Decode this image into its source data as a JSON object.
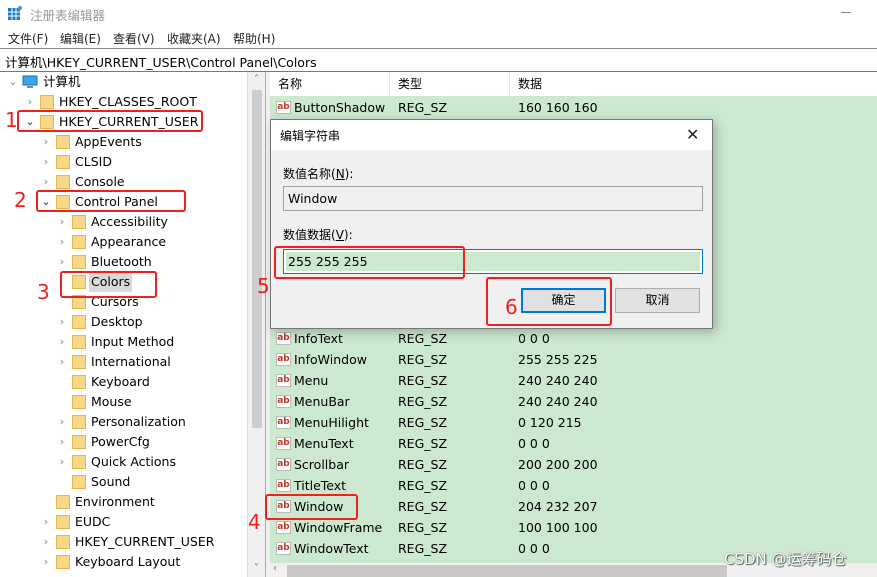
{
  "window": {
    "title": "注册表编辑器",
    "menu": [
      "文件(F)",
      "编辑(E)",
      "查看(V)",
      "收藏夹(A)",
      "帮助(H)"
    ],
    "address": "计算机\\HKEY_CURRENT_USER\\Control Panel\\Colors"
  },
  "tree": {
    "root": "计算机",
    "items": [
      {
        "label": "HKEY_CLASSES_ROOT",
        "level": 1,
        "expander": "collapsed"
      },
      {
        "label": "HKEY_CURRENT_USER",
        "level": 1,
        "expander": "expanded"
      },
      {
        "label": "AppEvents",
        "level": 2,
        "expander": "collapsed"
      },
      {
        "label": "CLSID",
        "level": 2,
        "expander": "collapsed"
      },
      {
        "label": "Console",
        "level": 2,
        "expander": "collapsed"
      },
      {
        "label": "Control Panel",
        "level": 2,
        "expander": "expanded"
      },
      {
        "label": "Accessibility",
        "level": 3,
        "expander": "collapsed"
      },
      {
        "label": "Appearance",
        "level": 3,
        "expander": "collapsed"
      },
      {
        "label": "Bluetooth",
        "level": 3,
        "expander": "collapsed"
      },
      {
        "label": "Colors",
        "level": 3,
        "expander": "none",
        "selected": true
      },
      {
        "label": "Cursors",
        "level": 3,
        "expander": "none"
      },
      {
        "label": "Desktop",
        "level": 3,
        "expander": "collapsed"
      },
      {
        "label": "Input Method",
        "level": 3,
        "expander": "collapsed"
      },
      {
        "label": "International",
        "level": 3,
        "expander": "collapsed"
      },
      {
        "label": "Keyboard",
        "level": 3,
        "expander": "none"
      },
      {
        "label": "Mouse",
        "level": 3,
        "expander": "none"
      },
      {
        "label": "Personalization",
        "level": 3,
        "expander": "collapsed"
      },
      {
        "label": "PowerCfg",
        "level": 3,
        "expander": "collapsed"
      },
      {
        "label": "Quick Actions",
        "level": 3,
        "expander": "collapsed"
      },
      {
        "label": "Sound",
        "level": 3,
        "expander": "none"
      },
      {
        "label": "Environment",
        "level": 2,
        "expander": "none"
      },
      {
        "label": "EUDC",
        "level": 2,
        "expander": "collapsed"
      },
      {
        "label": "HKEY_CURRENT_USER",
        "level": 2,
        "expander": "collapsed"
      },
      {
        "label": "Keyboard Layout",
        "level": 2,
        "expander": "collapsed"
      }
    ]
  },
  "list": {
    "columns": [
      "名称",
      "类型",
      "数据"
    ],
    "rows_top": [
      {
        "name": "ButtonShadow",
        "type": "REG_SZ",
        "data": "160 160 160"
      }
    ],
    "rows": [
      {
        "name": "InfoText",
        "type": "REG_SZ",
        "data": "0 0 0"
      },
      {
        "name": "InfoWindow",
        "type": "REG_SZ",
        "data": "255 255 225"
      },
      {
        "name": "Menu",
        "type": "REG_SZ",
        "data": "240 240 240"
      },
      {
        "name": "MenuBar",
        "type": "REG_SZ",
        "data": "240 240 240"
      },
      {
        "name": "MenuHilight",
        "type": "REG_SZ",
        "data": "0 120 215"
      },
      {
        "name": "MenuText",
        "type": "REG_SZ",
        "data": "0 0 0"
      },
      {
        "name": "Scrollbar",
        "type": "REG_SZ",
        "data": "200 200 200"
      },
      {
        "name": "TitleText",
        "type": "REG_SZ",
        "data": "0 0 0"
      },
      {
        "name": "Window",
        "type": "REG_SZ",
        "data": "204 232 207"
      },
      {
        "name": "WindowFrame",
        "type": "REG_SZ",
        "data": "100 100 100"
      },
      {
        "name": "WindowText",
        "type": "REG_SZ",
        "data": "0 0 0"
      }
    ]
  },
  "dialog": {
    "title": "编辑字符串",
    "name_label_prefix": "数值名称(",
    "name_label_key": "N",
    "name_label_suffix": "):",
    "name_value": "Window",
    "data_label_prefix": "数值数据(",
    "data_label_key": "V",
    "data_label_suffix": "):",
    "data_value": "255 255 255",
    "ok_label": "确定",
    "cancel_label": "取消"
  },
  "annotations": [
    "1",
    "2",
    "3",
    "4",
    "5",
    "6"
  ],
  "watermark": "CSDN @运筹码仓",
  "colors": {
    "list_bg": "#cce8cf",
    "annotation": "#f02020",
    "focus": "#0078d7"
  }
}
